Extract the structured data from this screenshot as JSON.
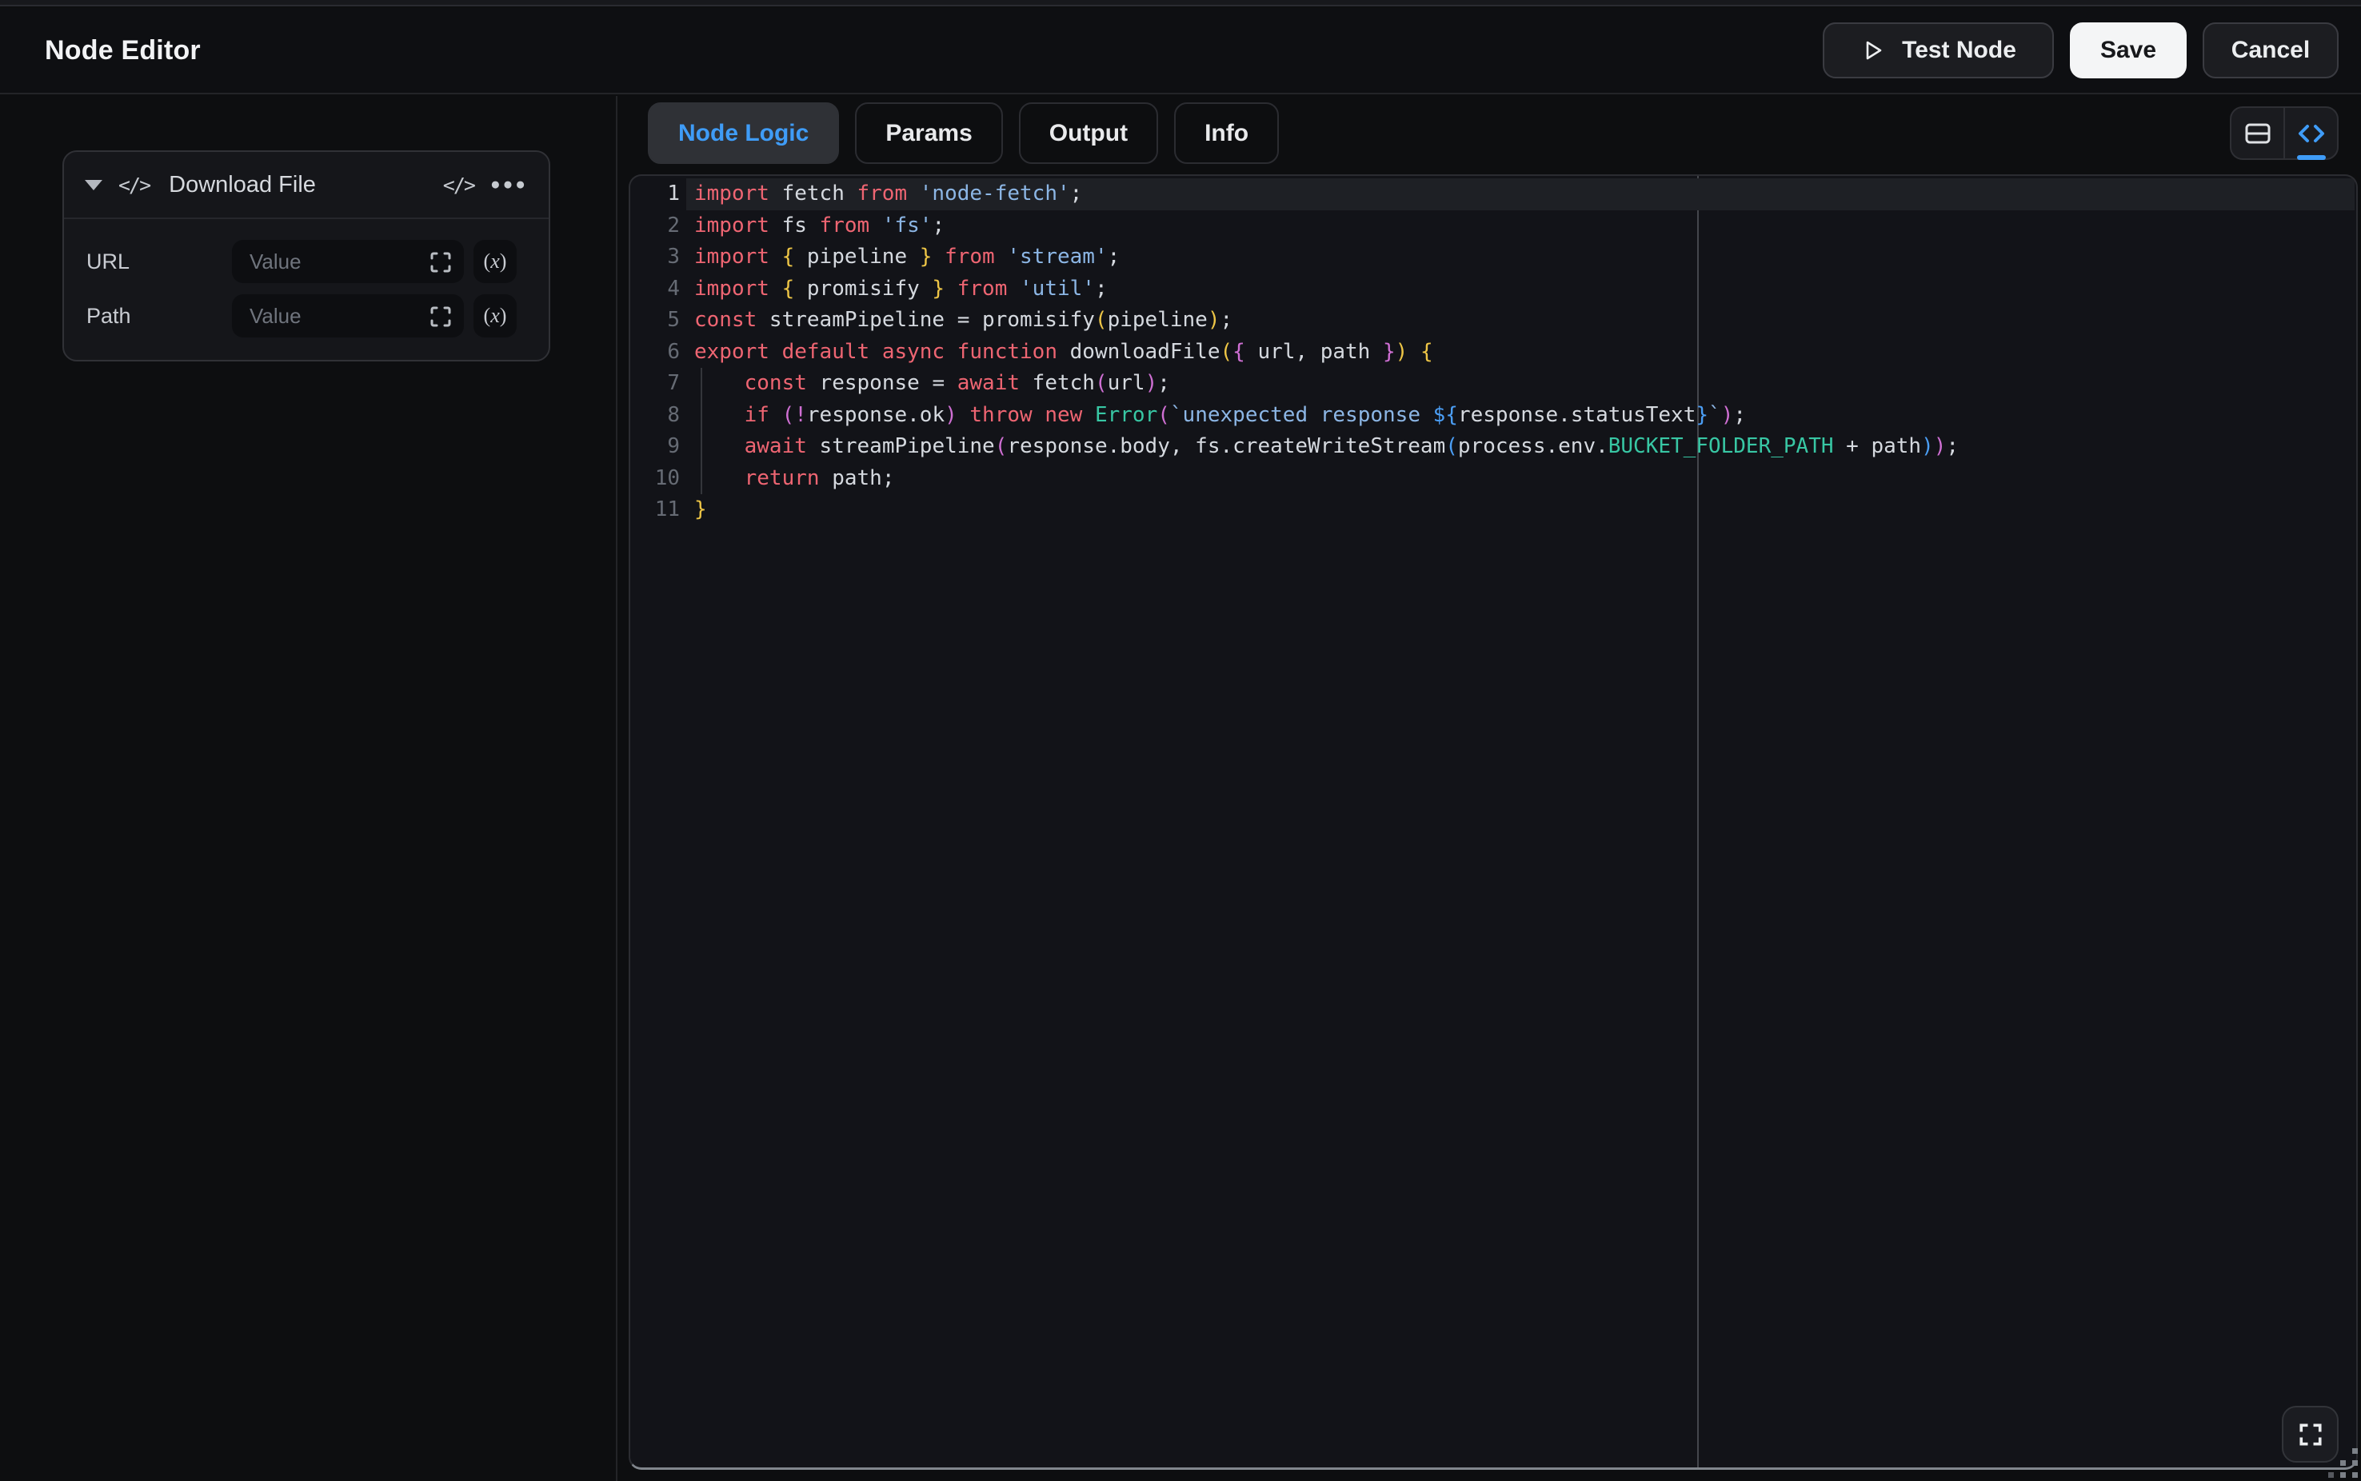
{
  "header": {
    "title": "Node Editor",
    "test_button": "Test Node",
    "save_button": "Save",
    "cancel_button": "Cancel"
  },
  "node_card": {
    "title": "Download File",
    "fields": [
      {
        "label": "URL",
        "value": "",
        "placeholder": "Value"
      },
      {
        "label": "Path",
        "value": "",
        "placeholder": "Value"
      }
    ]
  },
  "tabs": [
    {
      "label": "Node Logic",
      "active": true
    },
    {
      "label": "Params",
      "active": false
    },
    {
      "label": "Output",
      "active": false
    },
    {
      "label": "Info",
      "active": false
    }
  ],
  "view_toggle": {
    "options": [
      {
        "icon": "layout-rows",
        "active": false
      },
      {
        "icon": "code",
        "active": true
      }
    ]
  },
  "editor": {
    "language": "javascript",
    "active_line": 1,
    "ruler_column": 80,
    "lines": [
      {
        "num": 1,
        "tokens": [
          [
            "kw",
            "import"
          ],
          [
            "pl",
            " fetch "
          ],
          [
            "kw",
            "from"
          ],
          [
            "pl",
            " "
          ],
          [
            "str",
            "'node-fetch'"
          ],
          [
            "pl",
            ";"
          ]
        ]
      },
      {
        "num": 2,
        "tokens": [
          [
            "kw",
            "import"
          ],
          [
            "pl",
            " fs "
          ],
          [
            "kw",
            "from"
          ],
          [
            "pl",
            " "
          ],
          [
            "str",
            "'fs'"
          ],
          [
            "pl",
            ";"
          ]
        ]
      },
      {
        "num": 3,
        "tokens": [
          [
            "kw",
            "import"
          ],
          [
            "pl",
            " "
          ],
          [
            "b1",
            "{"
          ],
          [
            "pl",
            " pipeline "
          ],
          [
            "b1",
            "}"
          ],
          [
            "pl",
            " "
          ],
          [
            "kw",
            "from"
          ],
          [
            "pl",
            " "
          ],
          [
            "str",
            "'stream'"
          ],
          [
            "pl",
            ";"
          ]
        ]
      },
      {
        "num": 4,
        "tokens": [
          [
            "kw",
            "import"
          ],
          [
            "pl",
            " "
          ],
          [
            "b1",
            "{"
          ],
          [
            "pl",
            " promisify "
          ],
          [
            "b1",
            "}"
          ],
          [
            "pl",
            " "
          ],
          [
            "kw",
            "from"
          ],
          [
            "pl",
            " "
          ],
          [
            "str",
            "'util'"
          ],
          [
            "pl",
            ";"
          ]
        ]
      },
      {
        "num": 5,
        "tokens": [
          [
            "kw",
            "const"
          ],
          [
            "pl",
            " streamPipeline = promisify"
          ],
          [
            "b1",
            "("
          ],
          [
            "pl",
            "pipeline"
          ],
          [
            "b1",
            ")"
          ],
          [
            "pl",
            ";"
          ]
        ]
      },
      {
        "num": 6,
        "tokens": [
          [
            "kw",
            "export"
          ],
          [
            "pl",
            " "
          ],
          [
            "kw",
            "default"
          ],
          [
            "pl",
            " "
          ],
          [
            "kw",
            "async"
          ],
          [
            "pl",
            " "
          ],
          [
            "kw",
            "function"
          ],
          [
            "pl",
            " downloadFile"
          ],
          [
            "b1",
            "("
          ],
          [
            "b2",
            "{"
          ],
          [
            "pl",
            " url, path "
          ],
          [
            "b2",
            "}"
          ],
          [
            "b1",
            ")"
          ],
          [
            "pl",
            " "
          ],
          [
            "b1",
            "{"
          ]
        ]
      },
      {
        "num": 7,
        "tokens": [
          [
            "pl",
            "    "
          ],
          [
            "kw",
            "const"
          ],
          [
            "pl",
            " response = "
          ],
          [
            "kw",
            "await"
          ],
          [
            "pl",
            " fetch"
          ],
          [
            "b2",
            "("
          ],
          [
            "pl",
            "url"
          ],
          [
            "b2",
            ")"
          ],
          [
            "pl",
            ";"
          ]
        ]
      },
      {
        "num": 8,
        "tokens": [
          [
            "pl",
            "    "
          ],
          [
            "kw",
            "if"
          ],
          [
            "pl",
            " "
          ],
          [
            "b2",
            "("
          ],
          [
            "b2",
            "!"
          ],
          [
            "pl",
            "response.ok"
          ],
          [
            "b2",
            ")"
          ],
          [
            "pl",
            " "
          ],
          [
            "kw",
            "throw"
          ],
          [
            "pl",
            " "
          ],
          [
            "kw",
            "new"
          ],
          [
            "pl",
            " "
          ],
          [
            "cn",
            "Error"
          ],
          [
            "b2",
            "("
          ],
          [
            "str",
            "`unexpected response "
          ],
          [
            "b3",
            "${"
          ],
          [
            "pl",
            "response.statusText"
          ],
          [
            "b3",
            "}"
          ],
          [
            "str",
            "`"
          ],
          [
            "b2",
            ")"
          ],
          [
            "pl",
            ";"
          ]
        ]
      },
      {
        "num": 9,
        "tokens": [
          [
            "pl",
            "    "
          ],
          [
            "kw",
            "await"
          ],
          [
            "pl",
            " streamPipeline"
          ],
          [
            "b2",
            "("
          ],
          [
            "pl",
            "response.body, fs.createWriteStream"
          ],
          [
            "b3",
            "("
          ],
          [
            "pl",
            "process.env."
          ],
          [
            "cn",
            "BUCKET_FOLDER_PATH"
          ],
          [
            "pl",
            " + path"
          ],
          [
            "b3",
            ")"
          ],
          [
            "b2",
            ")"
          ],
          [
            "pl",
            ";"
          ]
        ]
      },
      {
        "num": 10,
        "tokens": [
          [
            "pl",
            "    "
          ],
          [
            "kw",
            "return"
          ],
          [
            "pl",
            " path;"
          ]
        ]
      },
      {
        "num": 11,
        "tokens": [
          [
            "b1",
            "}"
          ]
        ]
      }
    ]
  },
  "colors": {
    "accent": "#3f9cf7",
    "keyword": "#ee6572",
    "plain": "#d5d9df",
    "string": "#8cb6e5",
    "bracket_level1": "#edc546",
    "bracket_level2": "#cf6fd3",
    "bracket_level3": "#4b9ef5",
    "constant": "#38c7a4",
    "save_button_bg": "#f4f5f6",
    "active_tab_bg": "#2f3136"
  }
}
